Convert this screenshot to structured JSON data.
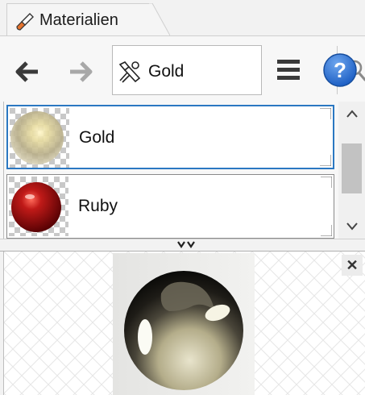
{
  "tab": {
    "title": "Materialien",
    "icon": "paint-brush-icon"
  },
  "toolbar": {
    "back_icon": "arrow-left-icon",
    "forward_icon": "arrow-right-icon",
    "search": {
      "value": "Gold",
      "icon": "magnifier-icon",
      "material_icon": "material-icon"
    },
    "menu_icon": "hamburger-menu-icon",
    "help_icon": "help-icon",
    "help_glyph": "?"
  },
  "materials": [
    {
      "name": "Gold",
      "selected": true
    },
    {
      "name": "Ruby",
      "selected": false
    }
  ],
  "preview": {
    "close_glyph": "✕"
  },
  "colors": {
    "selection": "#2b78c2",
    "ruby": "#b20d12",
    "help": "#1d5fc4"
  }
}
